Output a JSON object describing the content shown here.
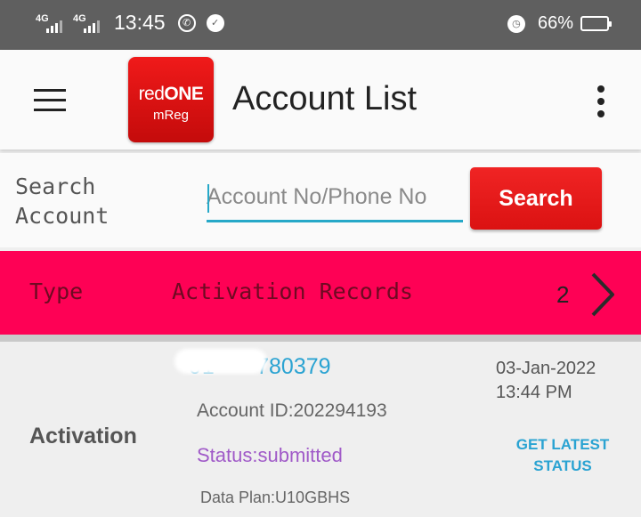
{
  "status_bar": {
    "signal1_label": "4G",
    "signal2_label": "4G",
    "time": "13:45",
    "battery_percent": "66%",
    "battery_level": 0.66,
    "battery_color": "#f6c300"
  },
  "app_bar": {
    "logo_red": "red",
    "logo_one": "ONE",
    "logo_sub": "mReg",
    "title": "Account List",
    "menu_icon": "hamburger-menu-icon",
    "more_icon": "vertical-dots-icon"
  },
  "search": {
    "label": "Search Account",
    "placeholder": "Account No/Phone No",
    "button_label": "Search"
  },
  "type_bar": {
    "type_label": "Type",
    "category_label": "Activation Records",
    "count": "2",
    "next_icon": "chevron-right-icon",
    "color": "#fe0155"
  },
  "record": {
    "type": "Activation",
    "phone_visible": "780379",
    "account_id": "Account ID:202294193",
    "status": "Status:submitted",
    "data_plan": "Data Plan:U10GBHS",
    "date": "03-Jan-2022",
    "time": "13:44 PM",
    "get_latest_label_line1": "GET LATEST",
    "get_latest_label_line2": "STATUS"
  }
}
